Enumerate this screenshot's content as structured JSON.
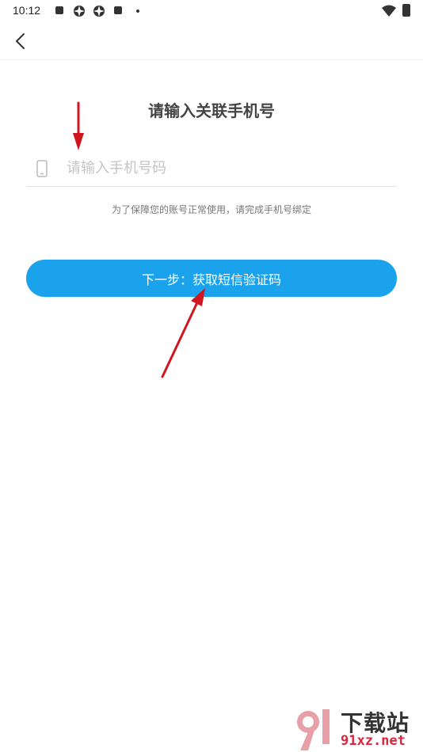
{
  "status_bar": {
    "time": "10:12"
  },
  "nav": {
    "back_icon": "chevron-left-icon"
  },
  "page": {
    "title": "请输入关联手机号"
  },
  "phone_field": {
    "icon": "phone-icon",
    "placeholder": "请输入手机号码",
    "value": ""
  },
  "hint": "为了保障您的账号正常使用，请完成手机号绑定",
  "next_button": {
    "label": "下一步：获取短信验证码"
  },
  "colors": {
    "accent": "#1aa3ec",
    "annotation_arrow": "#d0161e",
    "watermark_red": "#d7263d"
  },
  "watermark": {
    "title": "下载站",
    "url": "91xz.net"
  }
}
